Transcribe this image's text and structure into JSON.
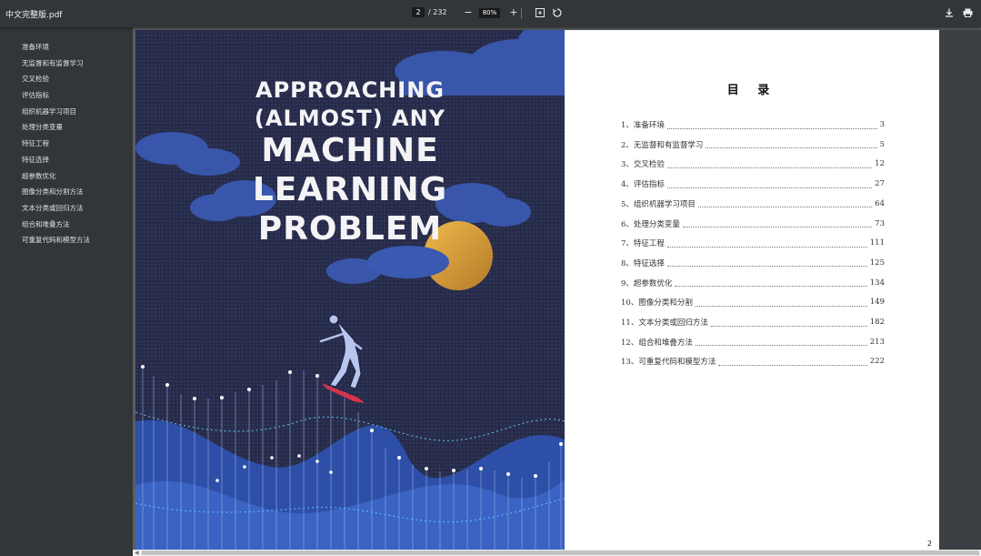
{
  "toolbar": {
    "title": "中文完整版.pdf",
    "current_page": "2",
    "total_pages": "/ 232",
    "zoom": "80%",
    "zoom_out_icon": "minus-icon",
    "zoom_in_icon": "plus-icon",
    "fit_icon": "fit-page-icon",
    "rotate_icon": "rotate-icon",
    "download_icon": "download-icon",
    "print_icon": "print-icon"
  },
  "sidebar": {
    "items": [
      {
        "label": "准备环境"
      },
      {
        "label": "无监督和有监督学习"
      },
      {
        "label": "交叉检验"
      },
      {
        "label": "评估指标"
      },
      {
        "label": "组织机器学习项目"
      },
      {
        "label": "处理分类变量"
      },
      {
        "label": "特征工程"
      },
      {
        "label": "特征选择"
      },
      {
        "label": "超参数优化"
      },
      {
        "label": "图像分类和分割方法"
      },
      {
        "label": "文本分类或回归方法"
      },
      {
        "label": "组合和堆叠方法"
      },
      {
        "label": "可重复代码和模型方法"
      }
    ]
  },
  "cover": {
    "line1": "APPROACHING",
    "line2": "(ALMOST) ANY",
    "line3": "MACHINE",
    "line4": "LEARNING",
    "line5": "PROBLEM",
    "colors": {
      "background": "#2a2f4e",
      "cloud": "#3b5bb5",
      "sun": "#e0a63a",
      "wave": "#2e4fa8",
      "board": "#d9324d"
    }
  },
  "toc": {
    "heading": "目 录",
    "entries": [
      {
        "label": "1、准备环境",
        "page": "3"
      },
      {
        "label": "2、无监督和有监督学习",
        "page": "5"
      },
      {
        "label": "3、交叉检验",
        "page": "12"
      },
      {
        "label": "4、评估指标",
        "page": "27"
      },
      {
        "label": "5、组织机器学习项目",
        "page": "64"
      },
      {
        "label": "6、处理分类变量",
        "page": "73"
      },
      {
        "label": "7、特征工程",
        "page": "111"
      },
      {
        "label": "8、特征选择",
        "page": "125"
      },
      {
        "label": "9、超参数优化",
        "page": "134"
      },
      {
        "label": "10、图像分类和分割",
        "page": "149"
      },
      {
        "label": "11、文本分类或回归方法",
        "page": "182"
      },
      {
        "label": "12、组合和堆叠方法",
        "page": "213"
      },
      {
        "label": "13、可重复代码和模型方法",
        "page": "222"
      }
    ],
    "page_number": "2"
  }
}
